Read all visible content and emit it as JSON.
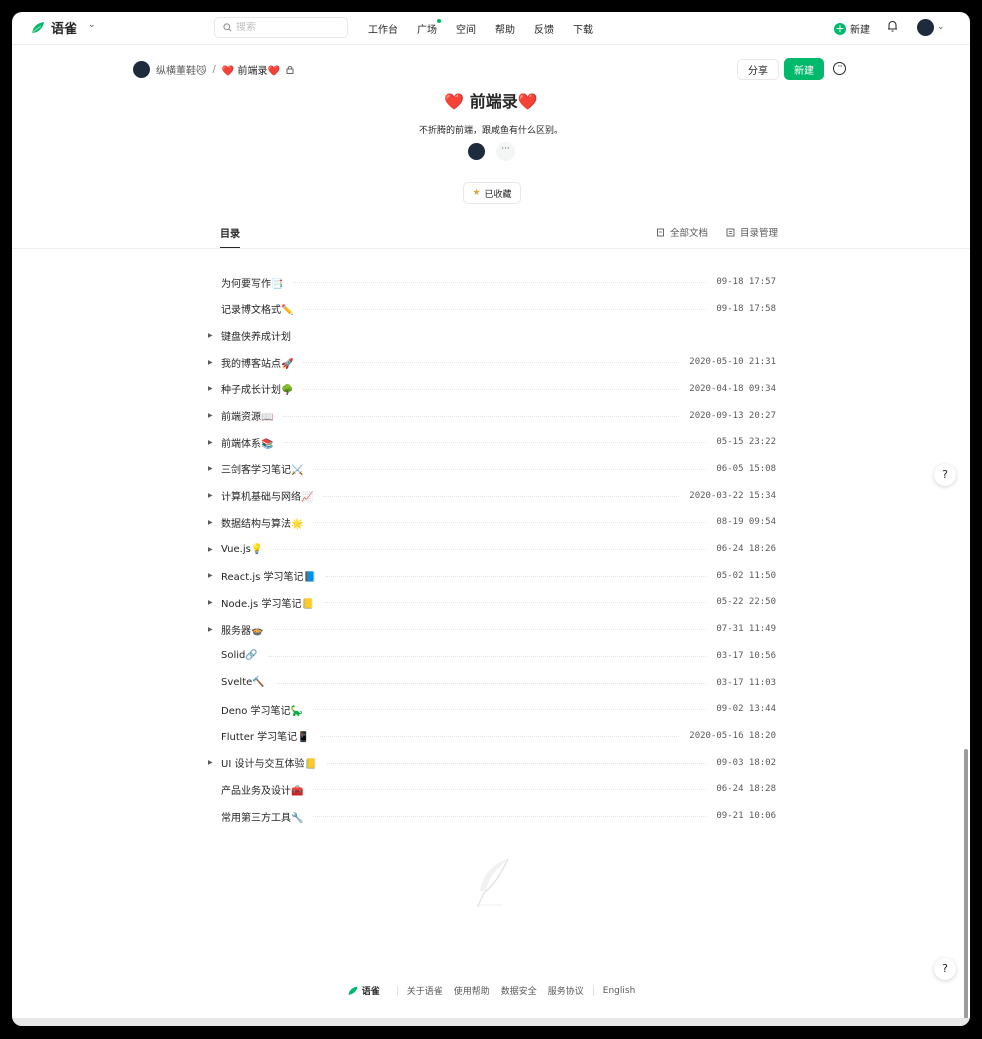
{
  "app": {
    "name": "语雀"
  },
  "header": {
    "search_placeholder": "搜索",
    "nav": [
      "工作台",
      "广场",
      "空间",
      "帮助",
      "反馈",
      "下载"
    ],
    "new_label": "新建"
  },
  "breadcrumb": {
    "user": "纵横董鞋😼",
    "sep": "/",
    "book": "❤️ 前端录❤️"
  },
  "actions": {
    "share": "分享",
    "new": "新建",
    "more": "···"
  },
  "book": {
    "title": "❤️ 前端录❤️",
    "description": "不折腾的前端，跟咸鱼有什么区别。",
    "members_more": "···",
    "favorite_label": "已收藏"
  },
  "tabs": {
    "catalog": "目录",
    "all_docs": "全部文档",
    "manage": "目录管理"
  },
  "catalog": [
    {
      "title": "为何要写作📑",
      "date": "09-18 17:57",
      "expandable": false
    },
    {
      "title": "记录博文格式✏️",
      "date": "09-18 17:58",
      "expandable": false
    },
    {
      "title": "键盘侠养成计划",
      "date": "",
      "expandable": true
    },
    {
      "title": "我的博客站点🚀",
      "date": "2020-05-10 21:31",
      "expandable": true
    },
    {
      "title": "种子成长计划🌳",
      "date": "2020-04-18 09:34",
      "expandable": true
    },
    {
      "title": "前端资源📖",
      "date": "2020-09-13 20:27",
      "expandable": true
    },
    {
      "title": "前端体系📚",
      "date": "05-15 23:22",
      "expandable": true
    },
    {
      "title": "三剑客学习笔记⚔️",
      "date": "06-05 15:08",
      "expandable": true
    },
    {
      "title": "计算机基础与网络📈",
      "date": "2020-03-22 15:34",
      "expandable": true
    },
    {
      "title": "数据结构与算法🌟",
      "date": "08-19 09:54",
      "expandable": true
    },
    {
      "title": "Vue.js💡",
      "date": "06-24 18:26",
      "expandable": true
    },
    {
      "title": "React.js 学习笔记📘",
      "date": "05-02 11:50",
      "expandable": true
    },
    {
      "title": "Node.js 学习笔记📒",
      "date": "05-22 22:50",
      "expandable": true
    },
    {
      "title": "服务器🍲",
      "date": "07-31 11:49",
      "expandable": true
    },
    {
      "title": "Solid🔗",
      "date": "03-17 10:56",
      "expandable": false
    },
    {
      "title": "Svelte🔨",
      "date": "03-17 11:03",
      "expandable": false
    },
    {
      "title": "Deno 学习笔记🦕",
      "date": "09-02 13:44",
      "expandable": false
    },
    {
      "title": "Flutter 学习笔记📱",
      "date": "2020-05-16 18:20",
      "expandable": false
    },
    {
      "title": "UI 设计与交互体验📒",
      "date": "09-03 18:02",
      "expandable": true
    },
    {
      "title": "产品业务及设计🧰",
      "date": "06-24 18:28",
      "expandable": false
    },
    {
      "title": "常用第三方工具🔧",
      "date": "09-21 10:06",
      "expandable": false
    }
  ],
  "footer": {
    "logo": "语雀",
    "links": [
      "关于语雀",
      "使用帮助",
      "数据安全",
      "服务协议"
    ],
    "lang": "English"
  },
  "help": "?",
  "colors": {
    "brand_green": "#00b96b",
    "text": "#262626",
    "muted": "#585a5a"
  },
  "icons": [
    "yuque-logo-icon",
    "search-icon",
    "bell-icon",
    "lock-icon",
    "star-icon",
    "doc-icon",
    "list-icon",
    "feather-icon"
  ]
}
